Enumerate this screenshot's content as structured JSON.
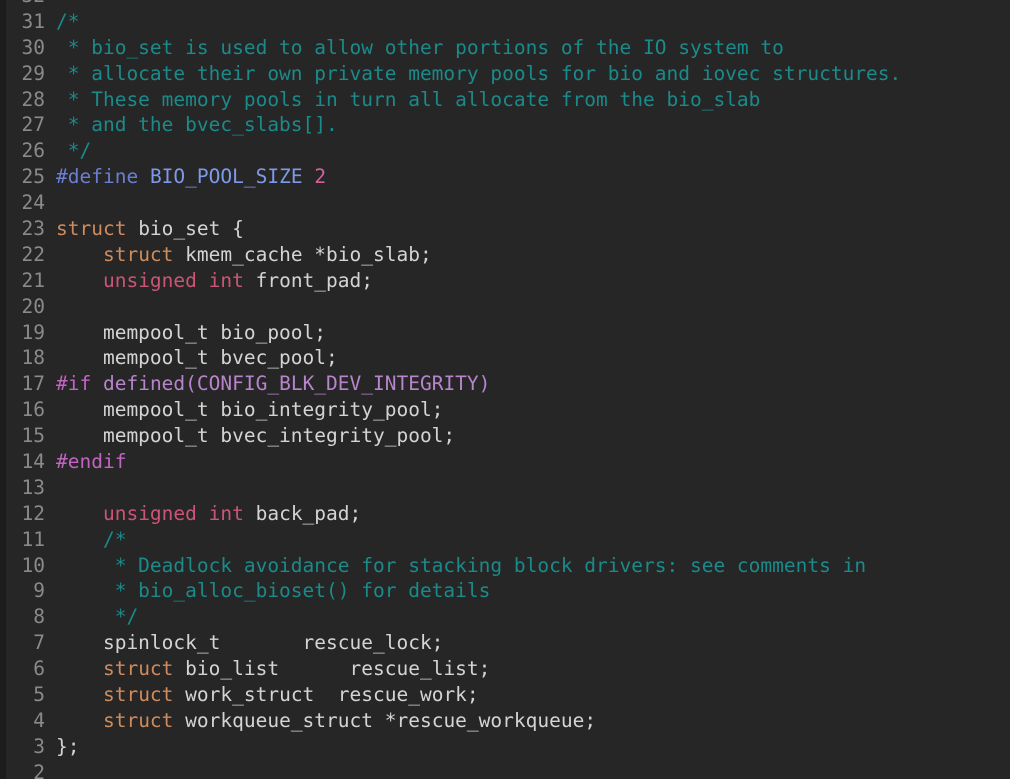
{
  "editor": {
    "name": "code-editor",
    "theme": "dark",
    "background": "#262626",
    "gutter_color": "#8a8a8a",
    "font_size_px": 19.5,
    "line_height_px": 25.9,
    "colors": {
      "plain": "#d4d4d4",
      "comment": "#1b8a8a",
      "preprocessor": "#6a7fd2",
      "preprocessor_identifier": "#7d9ae8",
      "number": "#d6619c",
      "conditional_directive": "#c264c2",
      "conditional_argument": "#b884cc",
      "struct_keyword": "#d08b5b",
      "type_keyword": "#cc5577"
    }
  },
  "lines": [
    {
      "number": "32",
      "partial": true,
      "tokens": [
        {
          "text": "",
          "cls": "t-plain"
        }
      ]
    },
    {
      "number": "31",
      "tokens": [
        {
          "text": "/*",
          "cls": "t-comment"
        }
      ]
    },
    {
      "number": "30",
      "tokens": [
        {
          "text": " * bio_set is used to allow other portions of the IO system to",
          "cls": "t-comment"
        }
      ]
    },
    {
      "number": "29",
      "tokens": [
        {
          "text": " * allocate their own private memory pools for bio and iovec structures.",
          "cls": "t-comment"
        }
      ]
    },
    {
      "number": "28",
      "tokens": [
        {
          "text": " * These memory pools in turn all allocate from the bio_slab",
          "cls": "t-comment"
        }
      ]
    },
    {
      "number": "27",
      "tokens": [
        {
          "text": " * and the bvec_slabs[].",
          "cls": "t-comment"
        }
      ]
    },
    {
      "number": "26",
      "tokens": [
        {
          "text": " */",
          "cls": "t-comment"
        }
      ]
    },
    {
      "number": "25",
      "tokens": [
        {
          "text": "#define",
          "cls": "t-pre"
        },
        {
          "text": " ",
          "cls": "t-plain"
        },
        {
          "text": "BIO_POOL_SIZE",
          "cls": "t-preid"
        },
        {
          "text": " ",
          "cls": "t-plain"
        },
        {
          "text": "2",
          "cls": "t-num"
        }
      ]
    },
    {
      "number": "24",
      "tokens": [
        {
          "text": "",
          "cls": "t-plain"
        }
      ]
    },
    {
      "number": "23",
      "tokens": [
        {
          "text": "struct",
          "cls": "t-struct"
        },
        {
          "text": " bio_set {",
          "cls": "t-plain"
        }
      ]
    },
    {
      "number": "22",
      "tokens": [
        {
          "text": "    ",
          "cls": "t-plain"
        },
        {
          "text": "struct",
          "cls": "t-struct"
        },
        {
          "text": " kmem_cache *bio_slab;",
          "cls": "t-plain"
        }
      ]
    },
    {
      "number": "21",
      "tokens": [
        {
          "text": "    ",
          "cls": "t-plain"
        },
        {
          "text": "unsigned int",
          "cls": "t-type"
        },
        {
          "text": " front_pad;",
          "cls": "t-plain"
        }
      ]
    },
    {
      "number": "20",
      "tokens": [
        {
          "text": "",
          "cls": "t-plain"
        }
      ]
    },
    {
      "number": "19",
      "tokens": [
        {
          "text": "    mempool_t bio_pool;",
          "cls": "t-plain"
        }
      ]
    },
    {
      "number": "18",
      "tokens": [
        {
          "text": "    mempool_t bvec_pool;",
          "cls": "t-plain"
        }
      ]
    },
    {
      "number": "17",
      "tokens": [
        {
          "text": "#if",
          "cls": "t-cond"
        },
        {
          "text": " ",
          "cls": "t-plain"
        },
        {
          "text": "defined(CONFIG_BLK_DEV_INTEGRITY)",
          "cls": "t-condarg"
        }
      ]
    },
    {
      "number": "16",
      "tokens": [
        {
          "text": "    mempool_t bio_integrity_pool;",
          "cls": "t-plain"
        }
      ]
    },
    {
      "number": "15",
      "tokens": [
        {
          "text": "    mempool_t bvec_integrity_pool;",
          "cls": "t-plain"
        }
      ]
    },
    {
      "number": "14",
      "tokens": [
        {
          "text": "#endif",
          "cls": "t-cond"
        }
      ]
    },
    {
      "number": "13",
      "tokens": [
        {
          "text": "",
          "cls": "t-plain"
        }
      ]
    },
    {
      "number": "12",
      "tokens": [
        {
          "text": "    ",
          "cls": "t-plain"
        },
        {
          "text": "unsigned int",
          "cls": "t-type"
        },
        {
          "text": " back_pad;",
          "cls": "t-plain"
        }
      ]
    },
    {
      "number": "11",
      "tokens": [
        {
          "text": "    /*",
          "cls": "t-comment"
        }
      ]
    },
    {
      "number": "10",
      "tokens": [
        {
          "text": "     * Deadlock avoidance for stacking block drivers: see comments in",
          "cls": "t-comment"
        }
      ]
    },
    {
      "number": "9",
      "tokens": [
        {
          "text": "     * bio_alloc_bioset() for details",
          "cls": "t-comment"
        }
      ]
    },
    {
      "number": "8",
      "tokens": [
        {
          "text": "     */",
          "cls": "t-comment"
        }
      ]
    },
    {
      "number": "7",
      "tokens": [
        {
          "text": "    spinlock_t       rescue_lock;",
          "cls": "t-plain"
        }
      ]
    },
    {
      "number": "6",
      "tokens": [
        {
          "text": "    ",
          "cls": "t-plain"
        },
        {
          "text": "struct",
          "cls": "t-struct"
        },
        {
          "text": " bio_list      rescue_list;",
          "cls": "t-plain"
        }
      ]
    },
    {
      "number": "5",
      "tokens": [
        {
          "text": "    ",
          "cls": "t-plain"
        },
        {
          "text": "struct",
          "cls": "t-struct"
        },
        {
          "text": " work_struct  rescue_work;",
          "cls": "t-plain"
        }
      ]
    },
    {
      "number": "4",
      "tokens": [
        {
          "text": "    ",
          "cls": "t-plain"
        },
        {
          "text": "struct",
          "cls": "t-struct"
        },
        {
          "text": " workqueue_struct *rescue_workqueue;",
          "cls": "t-plain"
        }
      ]
    },
    {
      "number": "3",
      "tokens": [
        {
          "text": "};",
          "cls": "t-plain"
        }
      ]
    },
    {
      "number": "2",
      "partial": true,
      "tokens": [
        {
          "text": "",
          "cls": "t-plain"
        }
      ]
    }
  ]
}
